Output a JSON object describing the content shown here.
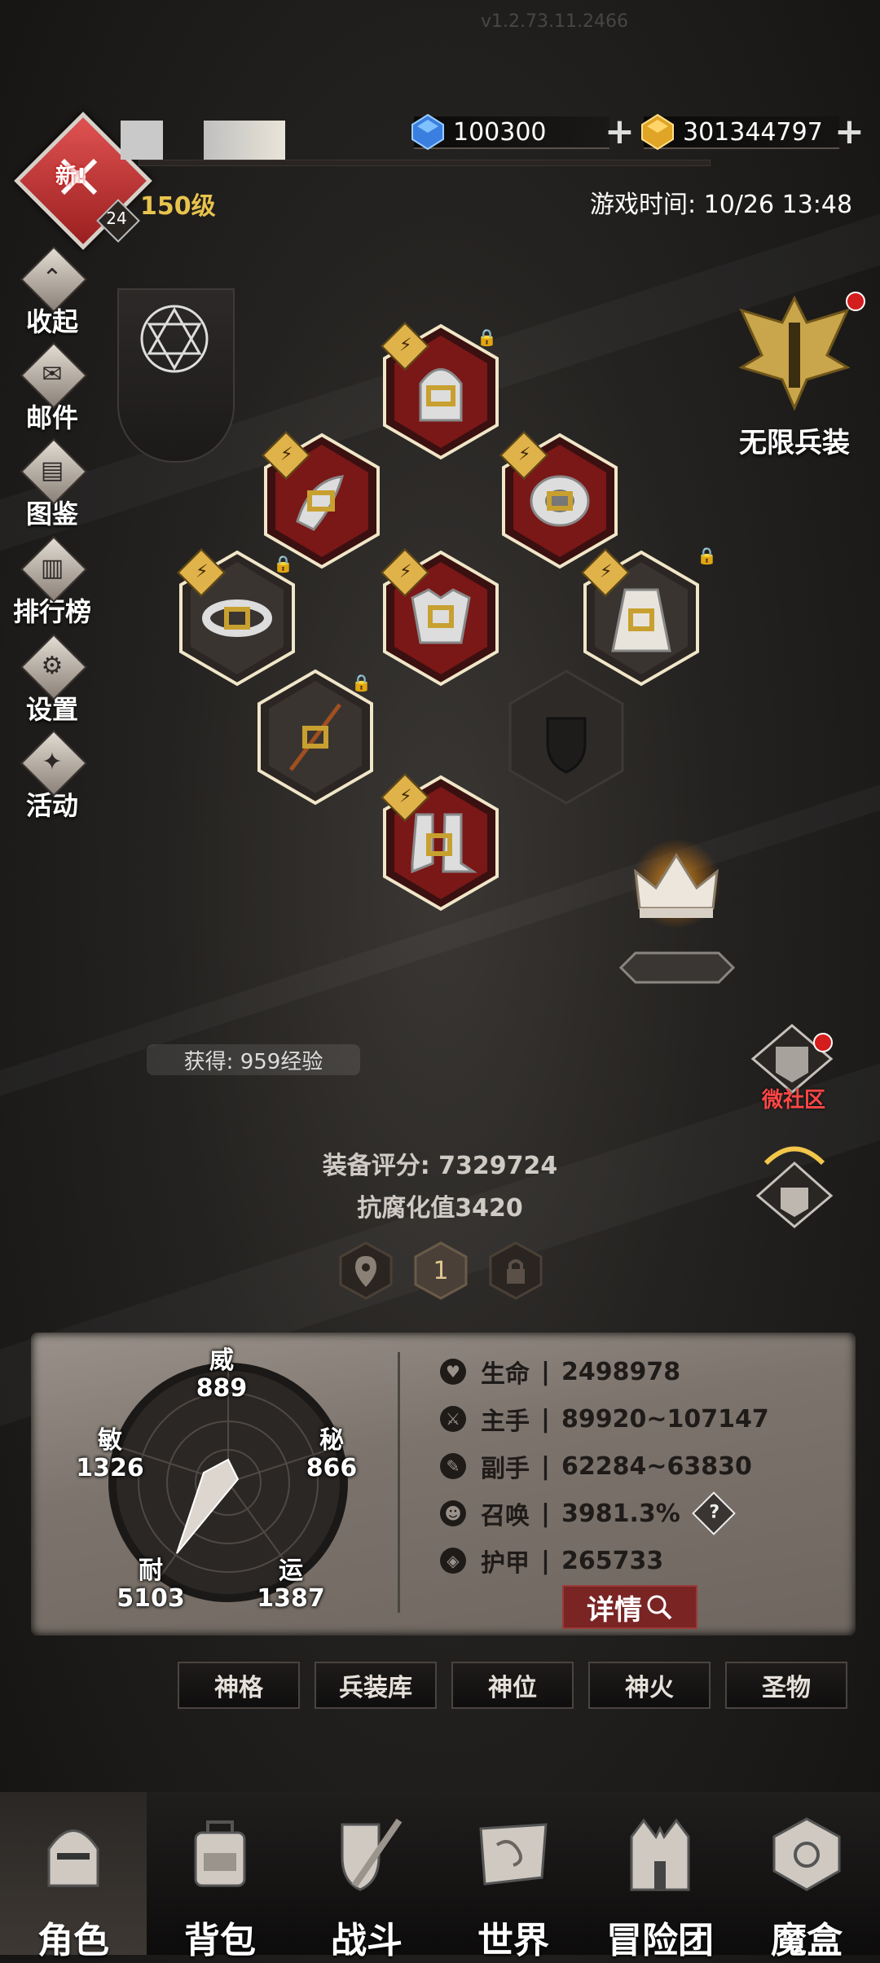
{
  "header": {
    "version_text": "v1.2.73.11.2466",
    "new_badge": "新!",
    "avatar_level": "24",
    "player_level": "150级",
    "diamond_amount": "100300",
    "gold_amount": "301344797",
    "game_time": "游戏时间: 10/26 13:48"
  },
  "left_menu": [
    {
      "label": "收起",
      "icon": "collapse-icon"
    },
    {
      "label": "邮件",
      "icon": "mail-icon"
    },
    {
      "label": "图鉴",
      "icon": "book-icon"
    },
    {
      "label": "排行榜",
      "icon": "ranking-icon"
    },
    {
      "label": "设置",
      "icon": "gear-icon"
    },
    {
      "label": "活动",
      "icon": "event-icon"
    }
  ],
  "right_side": {
    "infinite_gear_label": "无限兵装",
    "community_label": "微社区"
  },
  "equipment_slots": [
    {
      "name": "helmet",
      "badge": "⚡",
      "locked": true
    },
    {
      "name": "shoulder",
      "badge": "⚡",
      "locked": false
    },
    {
      "name": "ring-pendant",
      "badge": "⚡",
      "locked": false
    },
    {
      "name": "bracelet",
      "badge": "⚡",
      "locked": true
    },
    {
      "name": "chest-armor",
      "badge": "⚡",
      "locked": false
    },
    {
      "name": "cape",
      "badge": "⚡",
      "locked": true
    },
    {
      "name": "weapon",
      "badge": "",
      "locked": true
    },
    {
      "name": "boots",
      "badge": "⚡",
      "locked": false
    }
  ],
  "gain_text": "获得: 959经验",
  "equip_score": "装备评分: 7329724",
  "anti_corrosion": "抗腐化值3420",
  "page_tab_current": "1",
  "radar_stats": {
    "wei": {
      "label": "威",
      "value": "889"
    },
    "mi": {
      "label": "秘",
      "value": "866"
    },
    "yun": {
      "label": "运",
      "value": "1387"
    },
    "nai": {
      "label": "耐",
      "value": "5103"
    },
    "min": {
      "label": "敏",
      "value": "1326"
    }
  },
  "attributes": [
    {
      "icon": "heart-icon",
      "label": "生命",
      "value": "2498978"
    },
    {
      "icon": "mainhand-icon",
      "label": "主手",
      "value": "89920~107147"
    },
    {
      "icon": "offhand-icon",
      "label": "副手",
      "value": "62284~63830"
    },
    {
      "icon": "summon-icon",
      "label": "召唤",
      "value": "3981.3%"
    },
    {
      "icon": "armor-icon",
      "label": "护甲",
      "value": "265733"
    }
  ],
  "detail_button": "详情",
  "sub_tabs": [
    "神格",
    "兵装库",
    "神位",
    "神火",
    "圣物"
  ],
  "bottom_nav": [
    {
      "label": "角色",
      "active": true
    },
    {
      "label": "背包",
      "active": false
    },
    {
      "label": "战斗",
      "active": false
    },
    {
      "label": "世界",
      "active": false
    },
    {
      "label": "冒险团",
      "active": false
    },
    {
      "label": "魔盒",
      "active": false
    }
  ],
  "colors": {
    "accent_gold": "#e8c34d",
    "slot_red": "#c41e1e",
    "detail_button": "#7a2424",
    "notification_red": "#d41d1d"
  }
}
